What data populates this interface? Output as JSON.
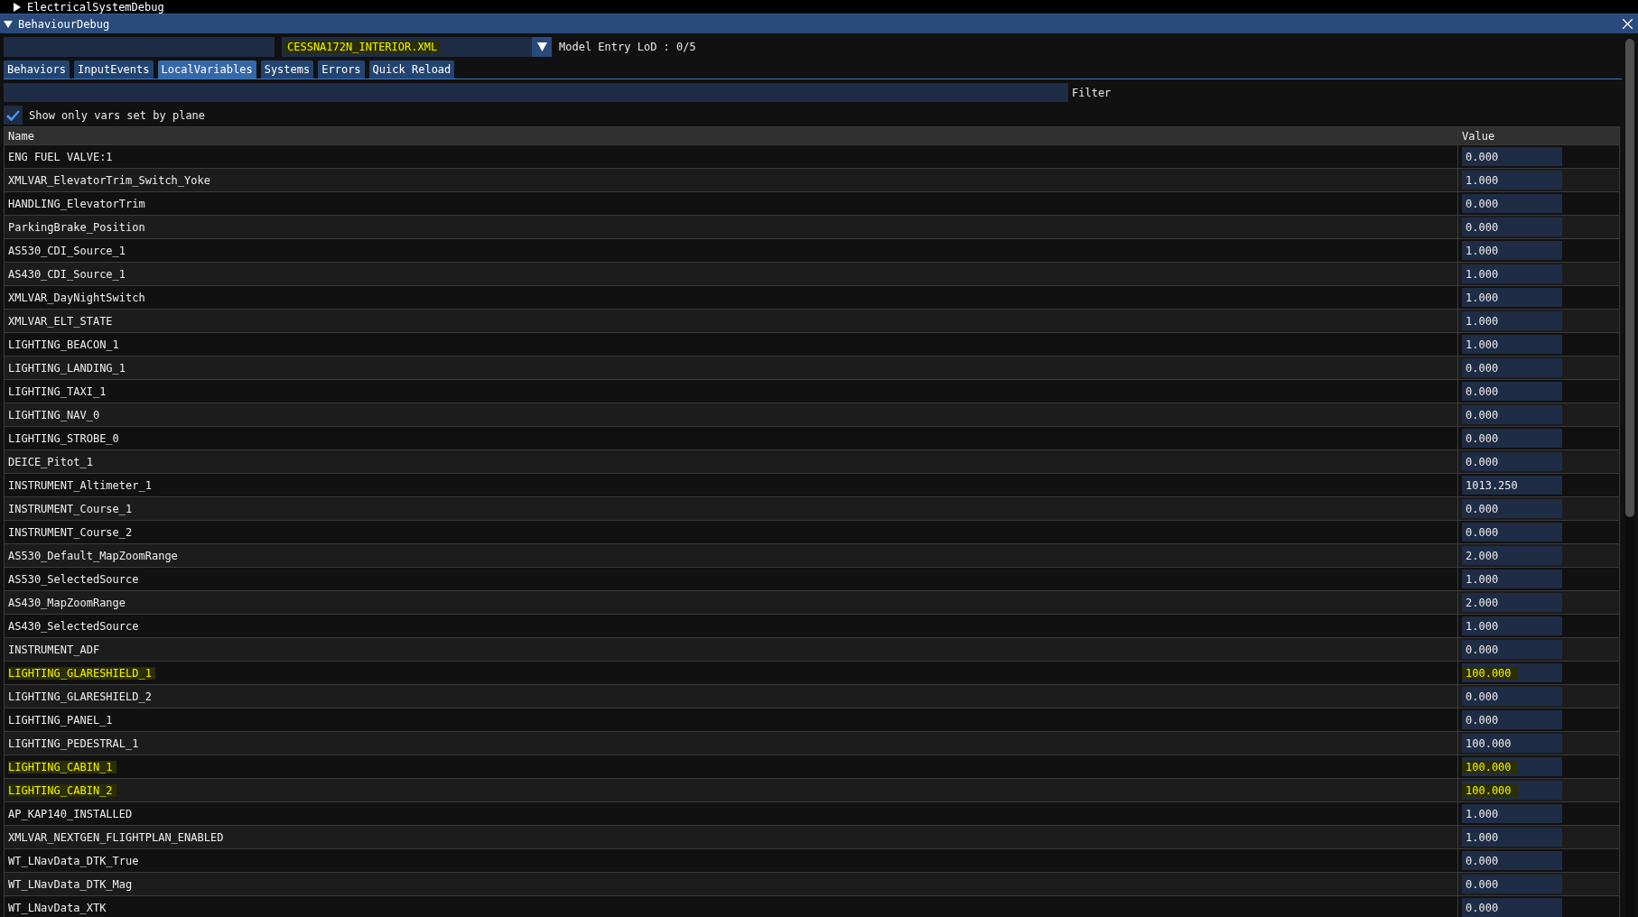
{
  "top_window": {
    "title": "ElectricalSystemDebug",
    "expanded": false
  },
  "window": {
    "title": "BehaviourDebug",
    "expanded": true
  },
  "toolbar": {
    "file_select": "CESSNA172N_INTERIOR.XML",
    "lod_label": "Model Entry LoD : 0/5"
  },
  "tabs": [
    {
      "label": "Behaviors",
      "selected": false
    },
    {
      "label": "InputEvents",
      "selected": false
    },
    {
      "label": "LocalVariables",
      "selected": true
    },
    {
      "label": "Systems",
      "selected": false
    },
    {
      "label": "Errors",
      "selected": false
    },
    {
      "label": "Quick Reload",
      "selected": false
    }
  ],
  "filter": {
    "label": "Filter"
  },
  "show_only_plane_vars": {
    "label": "Show only vars set by plane",
    "checked": true
  },
  "table": {
    "columns": [
      "Name",
      "Value"
    ],
    "rows": [
      {
        "name": "ENG FUEL VALVE:1",
        "value": "0.000",
        "highlighted": false
      },
      {
        "name": "XMLVAR_ElevatorTrim_Switch_Yoke",
        "value": "1.000",
        "highlighted": false
      },
      {
        "name": "HANDLING_ElevatorTrim",
        "value": "0.000",
        "highlighted": false
      },
      {
        "name": "ParkingBrake_Position",
        "value": "0.000",
        "highlighted": false
      },
      {
        "name": "AS530_CDI_Source_1",
        "value": "1.000",
        "highlighted": false
      },
      {
        "name": "AS430_CDI_Source_1",
        "value": "1.000",
        "highlighted": false
      },
      {
        "name": "XMLVAR_DayNightSwitch",
        "value": "1.000",
        "highlighted": false
      },
      {
        "name": "XMLVAR_ELT_STATE",
        "value": "1.000",
        "highlighted": false
      },
      {
        "name": "LIGHTING_BEACON_1",
        "value": "1.000",
        "highlighted": false
      },
      {
        "name": "LIGHTING_LANDING_1",
        "value": "0.000",
        "highlighted": false
      },
      {
        "name": "LIGHTING_TAXI_1",
        "value": "0.000",
        "highlighted": false
      },
      {
        "name": "LIGHTING_NAV_0",
        "value": "0.000",
        "highlighted": false
      },
      {
        "name": "LIGHTING_STROBE_0",
        "value": "0.000",
        "highlighted": false
      },
      {
        "name": "DEICE_Pitot_1",
        "value": "0.000",
        "highlighted": false
      },
      {
        "name": "INSTRUMENT_Altimeter_1",
        "value": "1013.250",
        "highlighted": false
      },
      {
        "name": "INSTRUMENT_Course_1",
        "value": "0.000",
        "highlighted": false
      },
      {
        "name": "INSTRUMENT_Course_2",
        "value": "0.000",
        "highlighted": false
      },
      {
        "name": "AS530_Default_MapZoomRange",
        "value": "2.000",
        "highlighted": false
      },
      {
        "name": "AS530_SelectedSource",
        "value": "1.000",
        "highlighted": false
      },
      {
        "name": "AS430_MapZoomRange",
        "value": "2.000",
        "highlighted": false
      },
      {
        "name": "AS430_SelectedSource",
        "value": "1.000",
        "highlighted": false
      },
      {
        "name": "INSTRUMENT_ADF",
        "value": "0.000",
        "highlighted": false
      },
      {
        "name": "LIGHTING_GLARESHIELD_1",
        "value": "100.000",
        "highlighted": true
      },
      {
        "name": "LIGHTING_GLARESHIELD_2",
        "value": "0.000",
        "highlighted": false
      },
      {
        "name": "LIGHTING_PANEL_1",
        "value": "0.000",
        "highlighted": false
      },
      {
        "name": "LIGHTING_PEDESTRAL_1",
        "value": "100.000",
        "highlighted": false
      },
      {
        "name": "LIGHTING_CABIN_1",
        "value": "100.000",
        "highlighted": true
      },
      {
        "name": "LIGHTING_CABIN_2",
        "value": "100.000",
        "highlighted": true
      },
      {
        "name": "AP_KAP140_INSTALLED",
        "value": "1.000",
        "highlighted": false
      },
      {
        "name": "XMLVAR_NEXTGEN_FLIGHTPLAN_ENABLED",
        "value": "1.000",
        "highlighted": false
      },
      {
        "name": "WT_LNavData_DTK_True",
        "value": "0.000",
        "highlighted": false
      },
      {
        "name": "WT_LNavData_DTK_Mag",
        "value": "0.000",
        "highlighted": false
      },
      {
        "name": "WT_LNavData_XTK",
        "value": "0.000",
        "highlighted": false
      }
    ]
  }
}
